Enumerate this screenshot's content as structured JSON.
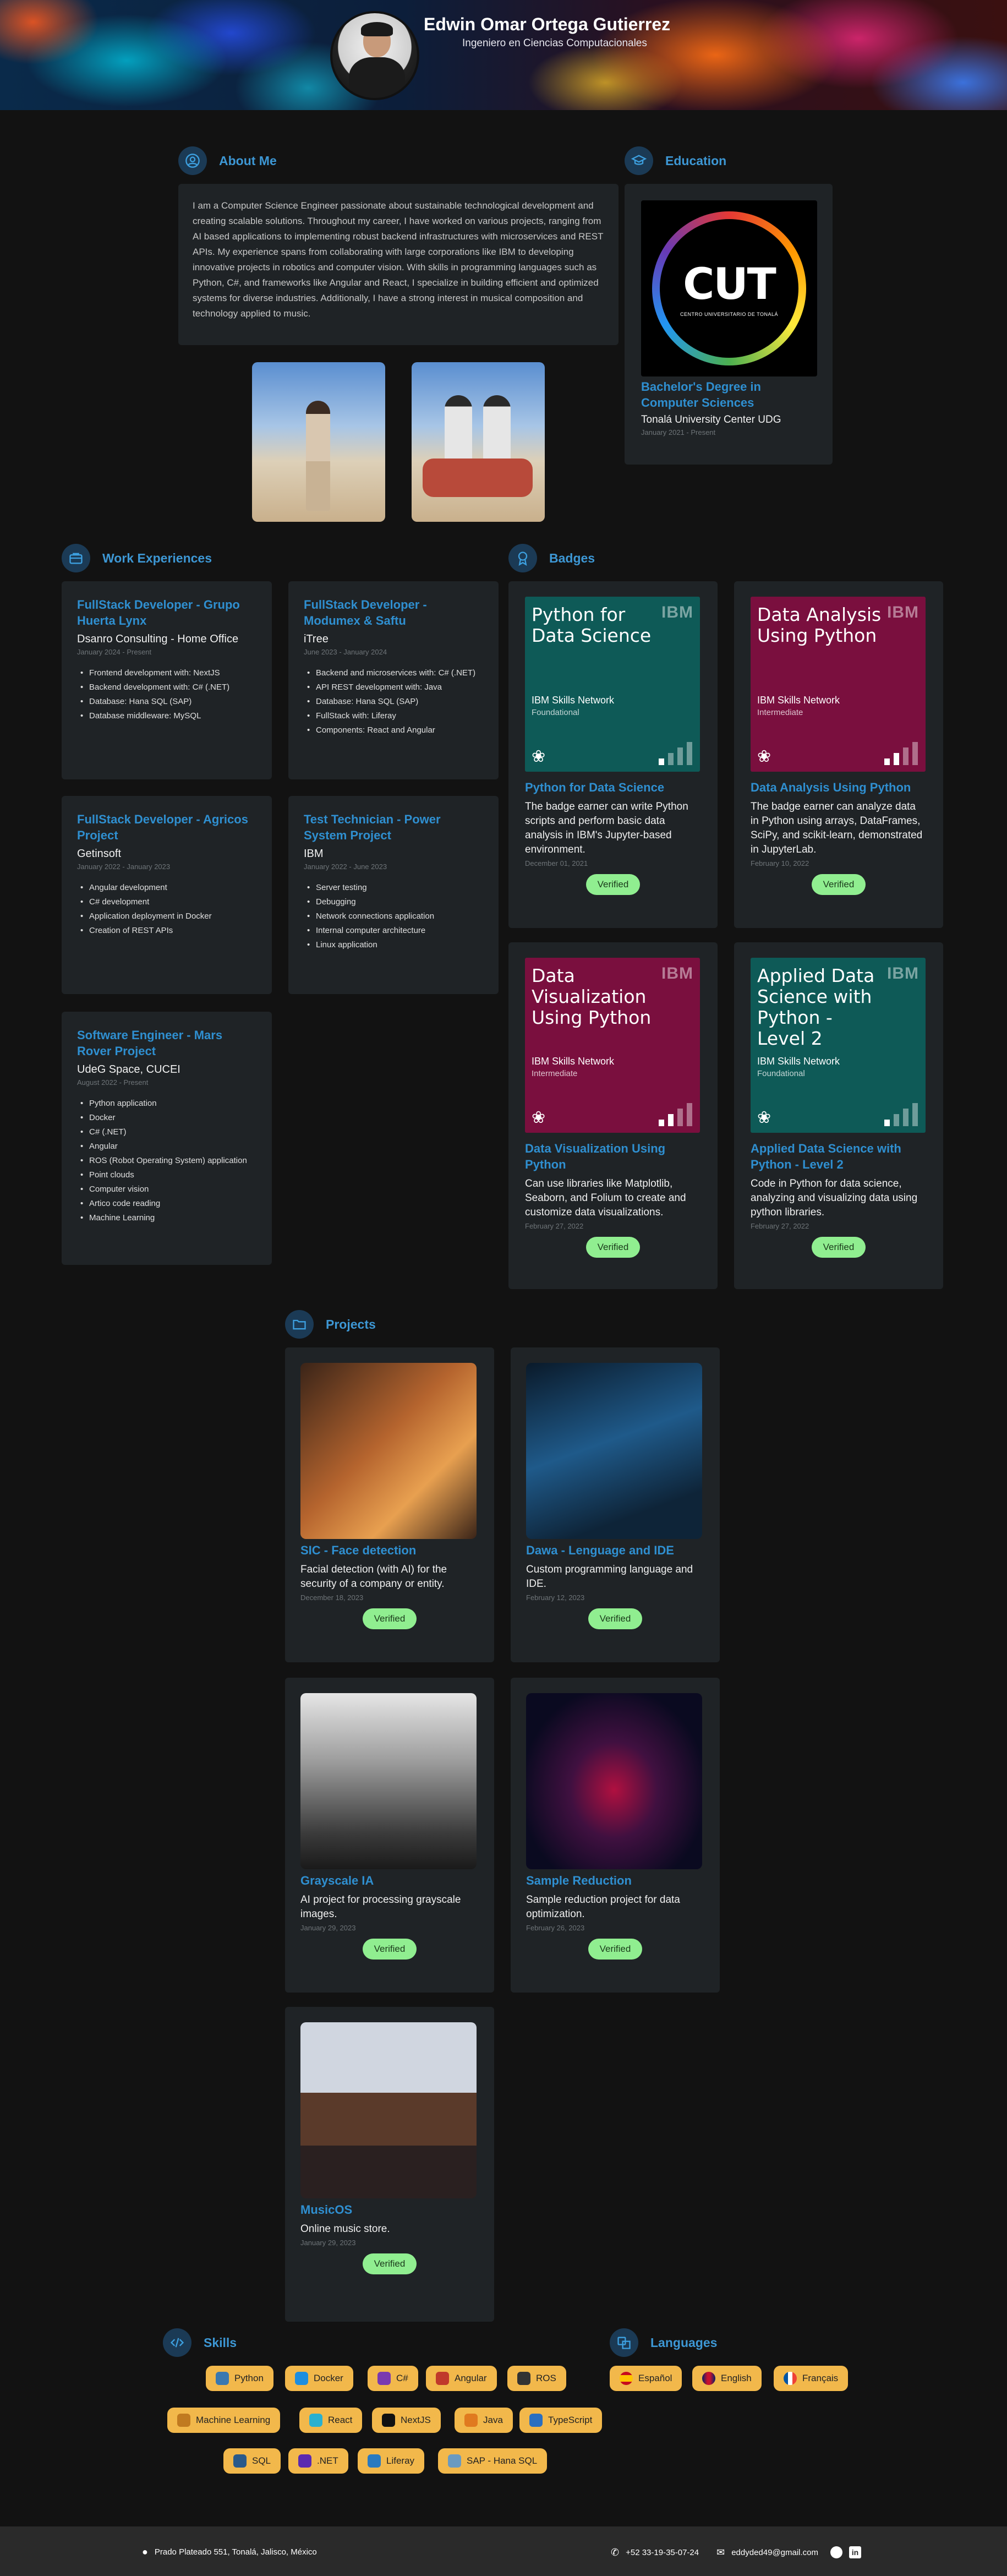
{
  "header": {
    "name": "Edwin Omar Ortega Gutierrez",
    "role": "Ingeniero en Ciencias Computacionales"
  },
  "about": {
    "title": "About Me",
    "text": "I am a Computer Science Engineer passionate about sustainable technological development and creating scalable solutions. Throughout my career, I have worked on various projects, ranging from AI based applications to implementing robust backend infrastructures with microservices and REST APIs. My experience spans from collaborating with large corporations like IBM to developing innovative projects in robotics and computer vision. With skills in programming languages such as Python, C#, and frameworks like Angular and React, I specialize in building efficient and optimized systems for diverse industries. Additionally, I have a strong interest in musical composition and technology applied to music."
  },
  "education": {
    "title": "Education",
    "logo_text": "CUT",
    "logo_caption": "CENTRO UNIVERSITARIO DE TONALÁ",
    "degree": "Bachelor's Degree in Computer Sciences",
    "school": "Tonalá University Center UDG",
    "dates": "January 2021 - Present"
  },
  "work": {
    "title": "Work Experiences",
    "jobs": [
      {
        "title": "FullStack Developer - Grupo Huerta Lynx",
        "company": "Dsanro Consulting - Home Office",
        "dates": "January 2024 - Present",
        "items": [
          "Frontend development with: NextJS",
          "Backend development with: C# (.NET)",
          "Database: Hana SQL (SAP)",
          "Database middleware: MySQL"
        ]
      },
      {
        "title": "FullStack Developer - Modumex & Saftu",
        "company": "iTree",
        "dates": "June 2023 - January 2024",
        "items": [
          "Backend and microservices with: C# (.NET)",
          "API REST development with: Java",
          "Database: Hana SQL (SAP)",
          "FullStack with: Liferay",
          "Components: React and Angular"
        ]
      },
      {
        "title": "FullStack Developer - Agricos Project",
        "company": "Getinsoft",
        "dates": "January 2022 - January 2023",
        "items": [
          "Angular development",
          "C# development",
          "Application deployment in Docker",
          "Creation of REST APIs"
        ]
      },
      {
        "title": "Test Technician - Power System Project",
        "company": "IBM",
        "dates": "January 2022 - June 2023",
        "items": [
          "Server testing",
          "Debugging",
          "Network connections application",
          "Internal computer architecture",
          "Linux application"
        ]
      },
      {
        "title": "Software Engineer - Mars Rover Project",
        "company": "UdeG Space, CUCEI",
        "dates": "August 2022 - Present",
        "items": [
          "Python application",
          "Docker",
          "C# (.NET)",
          "Angular",
          "ROS (Robot Operating System) application",
          "Point clouds",
          "Computer vision",
          "Artico code reading",
          "Machine Learning"
        ]
      }
    ]
  },
  "badges": {
    "title": "Badges",
    "verified_label": "Verified",
    "network": "IBM Skills Network",
    "ibm": "IBM",
    "items": [
      {
        "image_text": "Python for Data Science",
        "level": "Foundational",
        "color": "#0e5a57",
        "title": "Python for Data Science",
        "desc": "The badge earner can write Python scripts and perform basic data analysis in IBM's Jupyter-based environment.",
        "date": "December 01, 2021"
      },
      {
        "image_text": "Data Analysis Using Python",
        "level": "Intermediate",
        "color": "#7a0f3e",
        "title": "Data Analysis Using Python",
        "desc": "The badge earner can analyze data in Python using arrays, DataFrames, SciPy, and scikit-learn, demonstrated in JupyterLab.",
        "date": "February 10, 2022"
      },
      {
        "image_text": "Data Visualization Using Python",
        "level": "Intermediate",
        "color": "#7a0f3e",
        "title": "Data Visualization Using Python",
        "desc": "Can use libraries like Matplotlib, Seaborn, and Folium to create and customize data visualizations.",
        "date": "February 27, 2022"
      },
      {
        "image_text": "Applied Data Science with Python - Level 2",
        "level": "Foundational",
        "color": "#0e5a57",
        "title": "Applied Data Science with Python - Level 2",
        "desc": "Code in Python for data science, analyzing and visualizing data using python libraries.",
        "date": "February 27, 2022"
      }
    ]
  },
  "projects": {
    "title": "Projects",
    "verified_label": "Verified",
    "items": [
      {
        "title": "SIC - Face detection",
        "desc": "Facial detection (with AI) for the security of a company or entity.",
        "date": "December 18, 2023"
      },
      {
        "title": "Dawa - Lenguage and IDE",
        "desc": "Custom programming language and IDE.",
        "date": "February 12, 2023"
      },
      {
        "title": "Grayscale IA",
        "desc": "AI project for processing grayscale images.",
        "date": "January 29, 2023"
      },
      {
        "title": "Sample Reduction",
        "desc": "Sample reduction project for data optimization.",
        "date": "February 26, 2023"
      },
      {
        "title": "MusicOS",
        "desc": "Online music store.",
        "date": "January 29, 2023"
      }
    ]
  },
  "skills": {
    "title": "Skills",
    "items": [
      "Python",
      "Docker",
      "C#",
      "Angular",
      "ROS",
      "Machine Learning",
      "React",
      "NextJS",
      "Java",
      "TypeScript",
      "SQL",
      ".NET",
      "Liferay",
      "SAP - Hana SQL"
    ]
  },
  "languages": {
    "title": "Languages",
    "items": [
      "Español",
      "English",
      "Français"
    ]
  },
  "footer": {
    "address": "Prado Plateado 551, Tonalá, Jalisco, México",
    "phone": "+52 33-19-35-07-24",
    "email": "eddyded49@gmail.com"
  }
}
